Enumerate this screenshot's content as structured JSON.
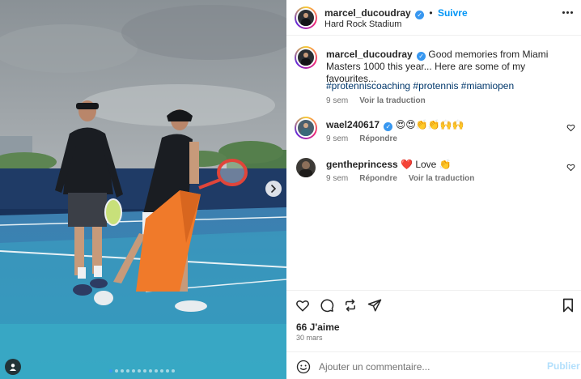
{
  "post": {
    "author": {
      "username": "marcel_ducoudray",
      "verified_icon": "verified-badge-icon",
      "follow_label": "Suivre",
      "follow_separator": "•",
      "location": "Hard Rock Stadium"
    },
    "caption": {
      "text": "Good memories from Miami Masters 1000 this year... Here are some of my favourites...",
      "hashtags": "#protenniscoaching #protennis #miamiopen",
      "age": "9 sem",
      "translate_label": "Voir la traduction"
    },
    "comments": [
      {
        "username": "wael240617",
        "verified": true,
        "text": "😍😍👏👏🙌🙌",
        "age": "9 sem",
        "reply_label": "Répondre"
      },
      {
        "username": "gentheprincess",
        "verified": false,
        "text": "❤️ Love 👏",
        "age": "9 sem",
        "reply_label": "Répondre",
        "translate_label": "Voir la traduction"
      }
    ],
    "likes": "66 J'aime",
    "date": "30 mars",
    "add_comment": {
      "placeholder": "Ajouter un commentaire...",
      "post_label": "Publier"
    },
    "media": {
      "slide_count": 12,
      "active_slide": 1
    }
  },
  "icons": {
    "more": "more-options-icon",
    "like": "heart-icon",
    "comment": "comment-icon",
    "share": "share-icon",
    "save": "bookmark-icon",
    "emoji": "emoji-icon",
    "next": "chevron-right-icon",
    "tag": "user-tag-icon"
  },
  "colors": {
    "accent": "#0095f6",
    "verified": "#3797f0",
    "text": "#262626",
    "muted": "#737373"
  }
}
